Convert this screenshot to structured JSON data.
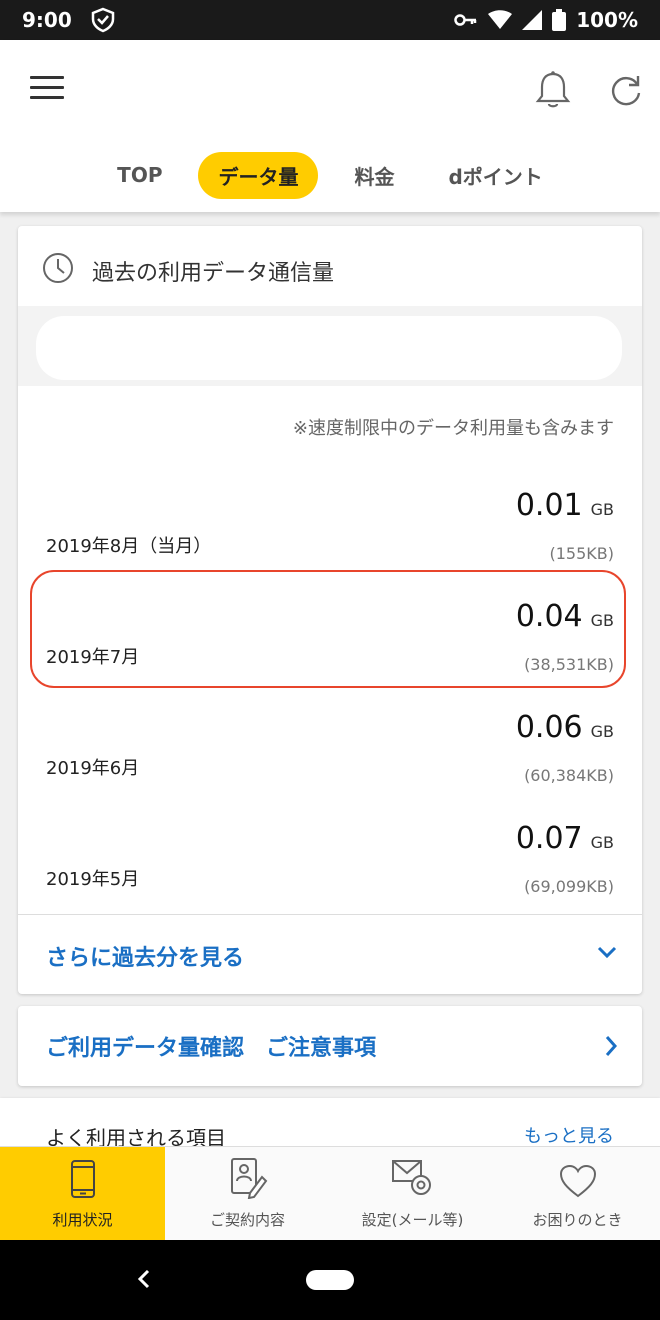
{
  "status_bar": {
    "time": "9:00",
    "battery": "100%"
  },
  "tabs": [
    {
      "label": "TOP",
      "active": false
    },
    {
      "label": "データ量",
      "active": true
    },
    {
      "label": "料金",
      "active": false
    },
    {
      "label": "dポイント",
      "active": false
    }
  ],
  "usage_card": {
    "title": "過去の利用データ通信量",
    "note": "※速度制限中のデータ利用量も含みます",
    "rows": [
      {
        "month": "2019年8月（当月）",
        "amount": "0.01",
        "unit": "GB",
        "kb": "(155KB)"
      },
      {
        "month": "2019年7月",
        "amount": "0.04",
        "unit": "GB",
        "kb": "(38,531KB)"
      },
      {
        "month": "2019年6月",
        "amount": "0.06",
        "unit": "GB",
        "kb": "(60,384KB)"
      },
      {
        "month": "2019年5月",
        "amount": "0.07",
        "unit": "GB",
        "kb": "(69,099KB)"
      }
    ],
    "highlighted_row": 1,
    "more_label": "さらに過去分を見る"
  },
  "notice_card": {
    "link_label": "ご利用データ量確認　ご注意事項"
  },
  "frequent": {
    "title": "よく利用される項目",
    "more_label": "もっと見る"
  },
  "bottom_nav": [
    {
      "label": "利用状況",
      "icon": "phone-icon",
      "active": true
    },
    {
      "label": "ご契約内容",
      "icon": "contract-icon",
      "active": false
    },
    {
      "label": "設定(メール等)",
      "icon": "mail-settings-icon",
      "active": false
    },
    {
      "label": "お困りのとき",
      "icon": "heart-icon",
      "active": false
    }
  ],
  "colors": {
    "accent": "#ffcc00",
    "link": "#1a6fc4",
    "highlight": "#e8452c"
  }
}
